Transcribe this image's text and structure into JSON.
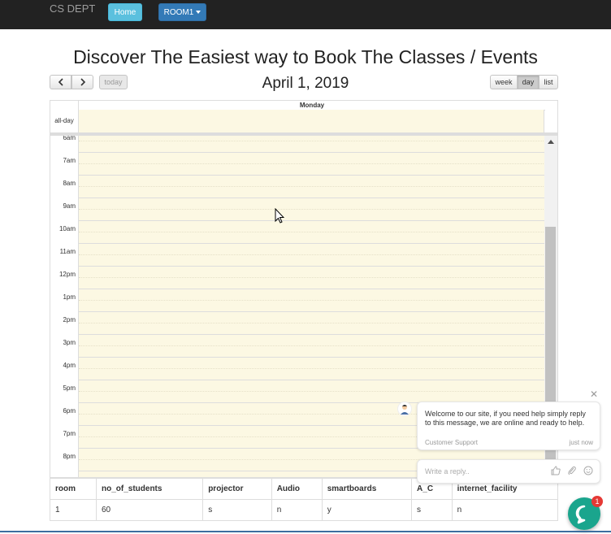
{
  "nav": {
    "brand": "CS DEPT",
    "home": "Home",
    "room": "ROOM1"
  },
  "page": {
    "title": "Discover The Easiest way to Book The Classes / Events",
    "date": "April 1, 2019"
  },
  "toolbar": {
    "today": "today",
    "week": "week",
    "day": "day",
    "list": "list",
    "active_view": "day"
  },
  "calendar": {
    "day_header": "Monday",
    "allday_label": "all-day",
    "times": [
      "6am",
      "7am",
      "8am",
      "9am",
      "10am",
      "11am",
      "12pm",
      "1pm",
      "2pm",
      "3pm",
      "4pm",
      "5pm",
      "6pm",
      "7pm",
      "8pm"
    ],
    "cell_color": "#fcf8e3"
  },
  "table": {
    "headers": [
      "room",
      "no_of_students",
      "projector",
      "Audio",
      "smartboards",
      "A_C",
      "internet_facility"
    ],
    "rows": [
      [
        "1",
        "60",
        "s",
        "n",
        "y",
        "s",
        "n"
      ]
    ]
  },
  "chat": {
    "message": "Welcome to our site, if you need help simply reply to this message, we are online and ready to help.",
    "sender": "Customer Support",
    "time": "just now",
    "reply_placeholder": "Write a reply..",
    "unread": "1",
    "accent": "#1aa58d"
  }
}
